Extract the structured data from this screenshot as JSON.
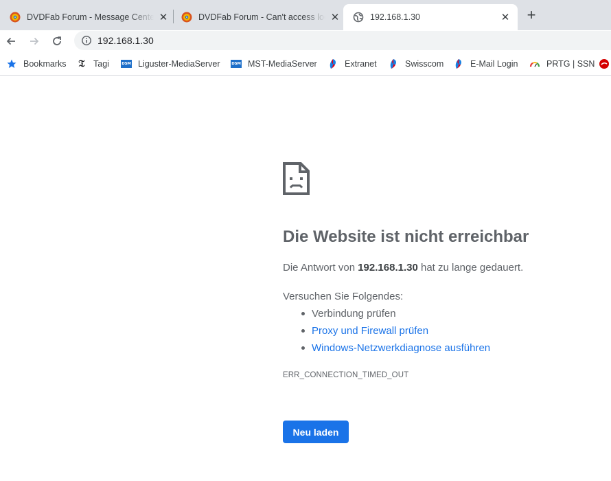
{
  "tabs": [
    {
      "title": "DVDFab Forum - Message Center",
      "icon": "dvdfab-icon",
      "active": false
    },
    {
      "title": "DVDFab Forum - Can't access local",
      "icon": "dvdfab-icon",
      "active": false
    },
    {
      "title": "192.168.1.30",
      "icon": "globe-icon",
      "active": true
    }
  ],
  "toolbar": {
    "url": "192.168.1.30"
  },
  "bookmarks": [
    {
      "label": "Bookmarks",
      "icon": "star-icon"
    },
    {
      "label": "Tagi",
      "icon": "tagi-icon"
    },
    {
      "label": "Liguster-MediaServer",
      "icon": "dsm-icon"
    },
    {
      "label": "MST-MediaServer",
      "icon": "dsm-icon"
    },
    {
      "label": "Extranet",
      "icon": "swisscom-icon"
    },
    {
      "label": "Swisscom",
      "icon": "swisscom-icon"
    },
    {
      "label": "E-Mail Login",
      "icon": "swisscom-icon"
    },
    {
      "label": "PRTG | SSN",
      "icon": "prtg-icon"
    }
  ],
  "error": {
    "heading": "Die Website ist nicht erreichbar",
    "summary_prefix": "Die Antwort von ",
    "summary_host": "192.168.1.30",
    "summary_suffix": " hat zu lange gedauert.",
    "try_heading": "Versuchen Sie Folgendes:",
    "suggestions": [
      {
        "text": "Verbindung prüfen",
        "link": false
      },
      {
        "text": "Proxy und Firewall prüfen",
        "link": true
      },
      {
        "text": "Windows-Netzwerkdiagnose ausführen",
        "link": true
      }
    ],
    "code": "ERR_CONNECTION_TIMED_OUT",
    "reload_label": "Neu laden"
  },
  "colors": {
    "accent": "#1a73e8",
    "text_secondary": "#5f6368",
    "tabstrip": "#dee1e6"
  }
}
